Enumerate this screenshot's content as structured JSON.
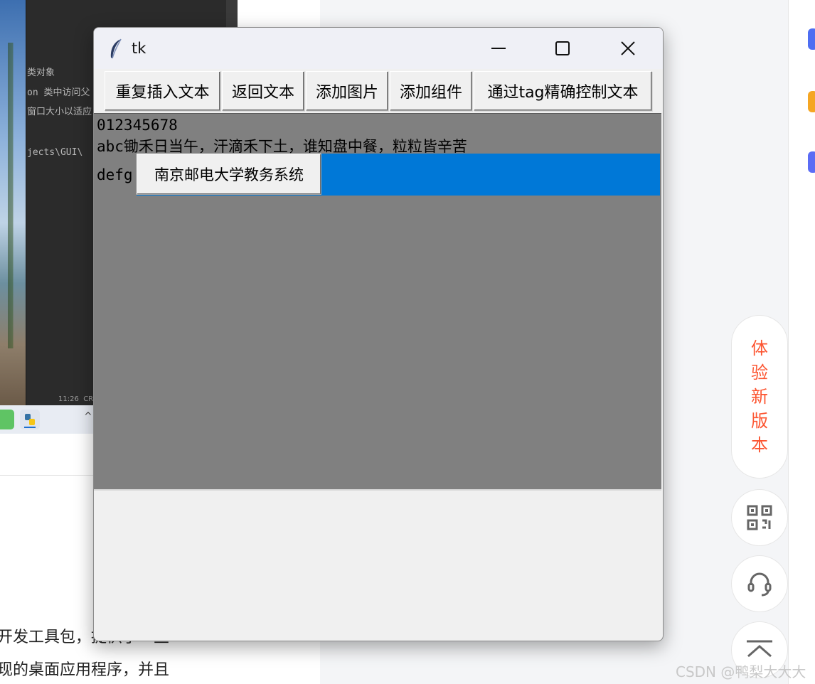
{
  "window": {
    "title": "tk",
    "icon": "tk-feather-icon"
  },
  "toolbar": {
    "buttons": [
      {
        "label": "重复插入文本"
      },
      {
        "label": "返回文本"
      },
      {
        "label": "添加图片"
      },
      {
        "label": "添加组件"
      },
      {
        "label": "通过tag精确控制文本"
      }
    ]
  },
  "text_widget": {
    "line1": "012345678",
    "line2": "abc锄禾日当午，汗滴禾下土，谁知盘中餐，粒粒皆辛苦",
    "line3_prefix": "defg",
    "embedded_button_label": "南京邮电大学教务系统",
    "selection_color": "#0078d7",
    "background": "#808080"
  },
  "background": {
    "ide_lines": [
      "类对象",
      "on 类中访问父",
      "窗口大小以适应",
      "jects\\GUI\\"
    ],
    "ide_status_time": "11:26",
    "ide_status_extra": "CR",
    "article_lines": [
      "开发工具包，提供了一些",
      "现的桌面应用程序，并且"
    ]
  },
  "sidebar": {
    "new_version_chars": [
      "体",
      "验",
      "新",
      "版",
      "本"
    ],
    "icons": [
      "qr-code-icon",
      "headset-icon",
      "back-to-top-icon"
    ]
  },
  "watermark": "CSDN @鸭梨大大大"
}
